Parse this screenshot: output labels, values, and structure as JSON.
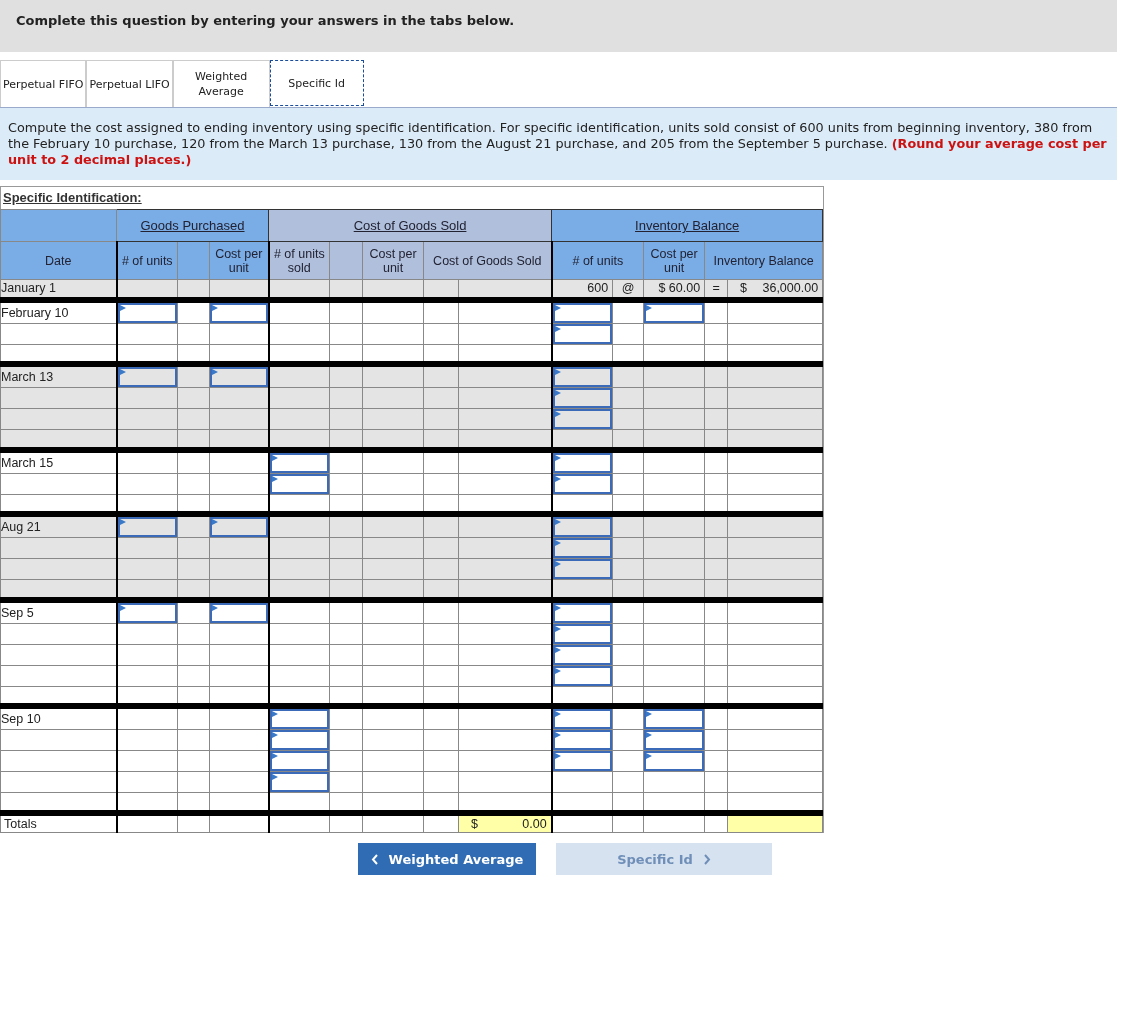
{
  "banner": "Complete this question by entering your answers in the tabs below.",
  "tabs": [
    {
      "label": "Perpetual FIFO",
      "selected": false
    },
    {
      "label": "Perpetual LIFO",
      "selected": false
    },
    {
      "label": "Weighted Average",
      "selected": false
    },
    {
      "label": "Specific Id",
      "selected": true
    }
  ],
  "instructions": "Compute the cost assigned to ending inventory using specific identification. For specific identification, units sold consist of 600 units from beginning inventory, 380 from the February 10 purchase, 120 from the March 13 purchase, 130 from the August 21 purchase, and 205 from the September 5 purchase. **(Round your average cost per unit to 2 decimal places.)**",
  "table": {
    "title": "Specific Identification:",
    "groups": [
      {
        "label": "Goods Purchased",
        "kind": "purchased"
      },
      {
        "label": "Cost of Goods Sold",
        "kind": "sold"
      },
      {
        "label": "Inventory Balance",
        "kind": "balance"
      }
    ],
    "columns": {
      "date": "Date",
      "purchased_units": "# of units",
      "purchased_cost": "Cost per unit",
      "sold_units": "# of units sold",
      "sold_cost": "Cost per unit",
      "cogs": "Cost of Goods Sold",
      "balance_units": "# of units",
      "balance_cost": "Cost per unit",
      "balance_amount": "Inventory Balance"
    },
    "sections": [
      {
        "shaded": true,
        "rows": [
          {
            "date": "January 1",
            "balance": {
              "units": "600",
              "at": "@",
              "cost": "$ 60.00",
              "equals": "=",
              "currency": "$",
              "amount": "36,000.00"
            }
          }
        ]
      },
      {
        "shaded": false,
        "rows": [
          {
            "date": "February 10",
            "fields": {
              "purchased_units": true,
              "purchased_cost": true,
              "sold_units": false,
              "balance_units": true,
              "balance_cost": true
            }
          },
          {
            "fields": {
              "purchased_units": false,
              "purchased_cost": false,
              "sold_units": false,
              "balance_units": true,
              "balance_cost": false
            }
          },
          {
            "fields": {
              "purchased_units": false,
              "purchased_cost": false,
              "sold_units": false,
              "balance_units": false,
              "balance_cost": false
            }
          }
        ]
      },
      {
        "shaded": true,
        "rows": [
          {
            "date": "March 13",
            "fields": {
              "purchased_units": true,
              "purchased_cost": true,
              "sold_units": false,
              "balance_units": true,
              "balance_cost": false
            }
          },
          {
            "fields": {
              "purchased_units": false,
              "purchased_cost": false,
              "sold_units": false,
              "balance_units": true,
              "balance_cost": false
            }
          },
          {
            "fields": {
              "purchased_units": false,
              "purchased_cost": false,
              "sold_units": false,
              "balance_units": true,
              "balance_cost": false
            }
          },
          {
            "fields": {
              "purchased_units": false,
              "purchased_cost": false,
              "sold_units": false,
              "balance_units": false,
              "balance_cost": false
            }
          }
        ]
      },
      {
        "shaded": false,
        "rows": [
          {
            "date": "March 15",
            "fields": {
              "purchased_units": false,
              "purchased_cost": false,
              "sold_units": true,
              "balance_units": true,
              "balance_cost": false
            }
          },
          {
            "fields": {
              "purchased_units": false,
              "purchased_cost": false,
              "sold_units": true,
              "balance_units": true,
              "balance_cost": false
            }
          },
          {
            "fields": {
              "purchased_units": false,
              "purchased_cost": false,
              "sold_units": false,
              "balance_units": false,
              "balance_cost": false
            }
          }
        ]
      },
      {
        "shaded": true,
        "rows": [
          {
            "date": "Aug 21",
            "fields": {
              "purchased_units": true,
              "purchased_cost": true,
              "sold_units": false,
              "balance_units": true,
              "balance_cost": false
            }
          },
          {
            "fields": {
              "purchased_units": false,
              "purchased_cost": false,
              "sold_units": false,
              "balance_units": true,
              "balance_cost": false
            }
          },
          {
            "fields": {
              "purchased_units": false,
              "purchased_cost": false,
              "sold_units": false,
              "balance_units": true,
              "balance_cost": false
            }
          },
          {
            "fields": {
              "purchased_units": false,
              "purchased_cost": false,
              "sold_units": false,
              "balance_units": false,
              "balance_cost": false
            }
          }
        ]
      },
      {
        "shaded": false,
        "rows": [
          {
            "date": "Sep 5",
            "fields": {
              "purchased_units": true,
              "purchased_cost": true,
              "sold_units": false,
              "balance_units": true,
              "balance_cost": false
            }
          },
          {
            "fields": {
              "purchased_units": false,
              "purchased_cost": false,
              "sold_units": false,
              "balance_units": true,
              "balance_cost": false
            }
          },
          {
            "fields": {
              "purchased_units": false,
              "purchased_cost": false,
              "sold_units": false,
              "balance_units": true,
              "balance_cost": false
            }
          },
          {
            "fields": {
              "purchased_units": false,
              "purchased_cost": false,
              "sold_units": false,
              "balance_units": true,
              "balance_cost": false
            }
          },
          {
            "fields": {
              "purchased_units": false,
              "purchased_cost": false,
              "sold_units": false,
              "balance_units": false,
              "balance_cost": false
            }
          }
        ]
      },
      {
        "shaded": false,
        "rows": [
          {
            "date": "Sep 10",
            "fields": {
              "purchased_units": false,
              "purchased_cost": false,
              "sold_units": true,
              "balance_units": true,
              "balance_cost": true
            }
          },
          {
            "fields": {
              "purchased_units": false,
              "purchased_cost": false,
              "sold_units": true,
              "balance_units": true,
              "balance_cost": true
            }
          },
          {
            "fields": {
              "purchased_units": false,
              "purchased_cost": false,
              "sold_units": true,
              "balance_units": true,
              "balance_cost": true
            }
          },
          {
            "fields": {
              "purchased_units": false,
              "purchased_cost": false,
              "sold_units": true,
              "balance_units": false,
              "balance_cost": false
            }
          },
          {
            "fields": {
              "purchased_units": false,
              "purchased_cost": false,
              "sold_units": false,
              "balance_units": false,
              "balance_cost": false
            }
          }
        ]
      }
    ],
    "totals": {
      "label": "Totals",
      "cogs_currency": "$",
      "cogs_amount": "0.00"
    }
  },
  "nav": [
    {
      "label": "Weighted Average",
      "kind": "prev",
      "disabled": false
    },
    {
      "label": "Specific Id",
      "kind": "next",
      "disabled": true
    }
  ]
}
